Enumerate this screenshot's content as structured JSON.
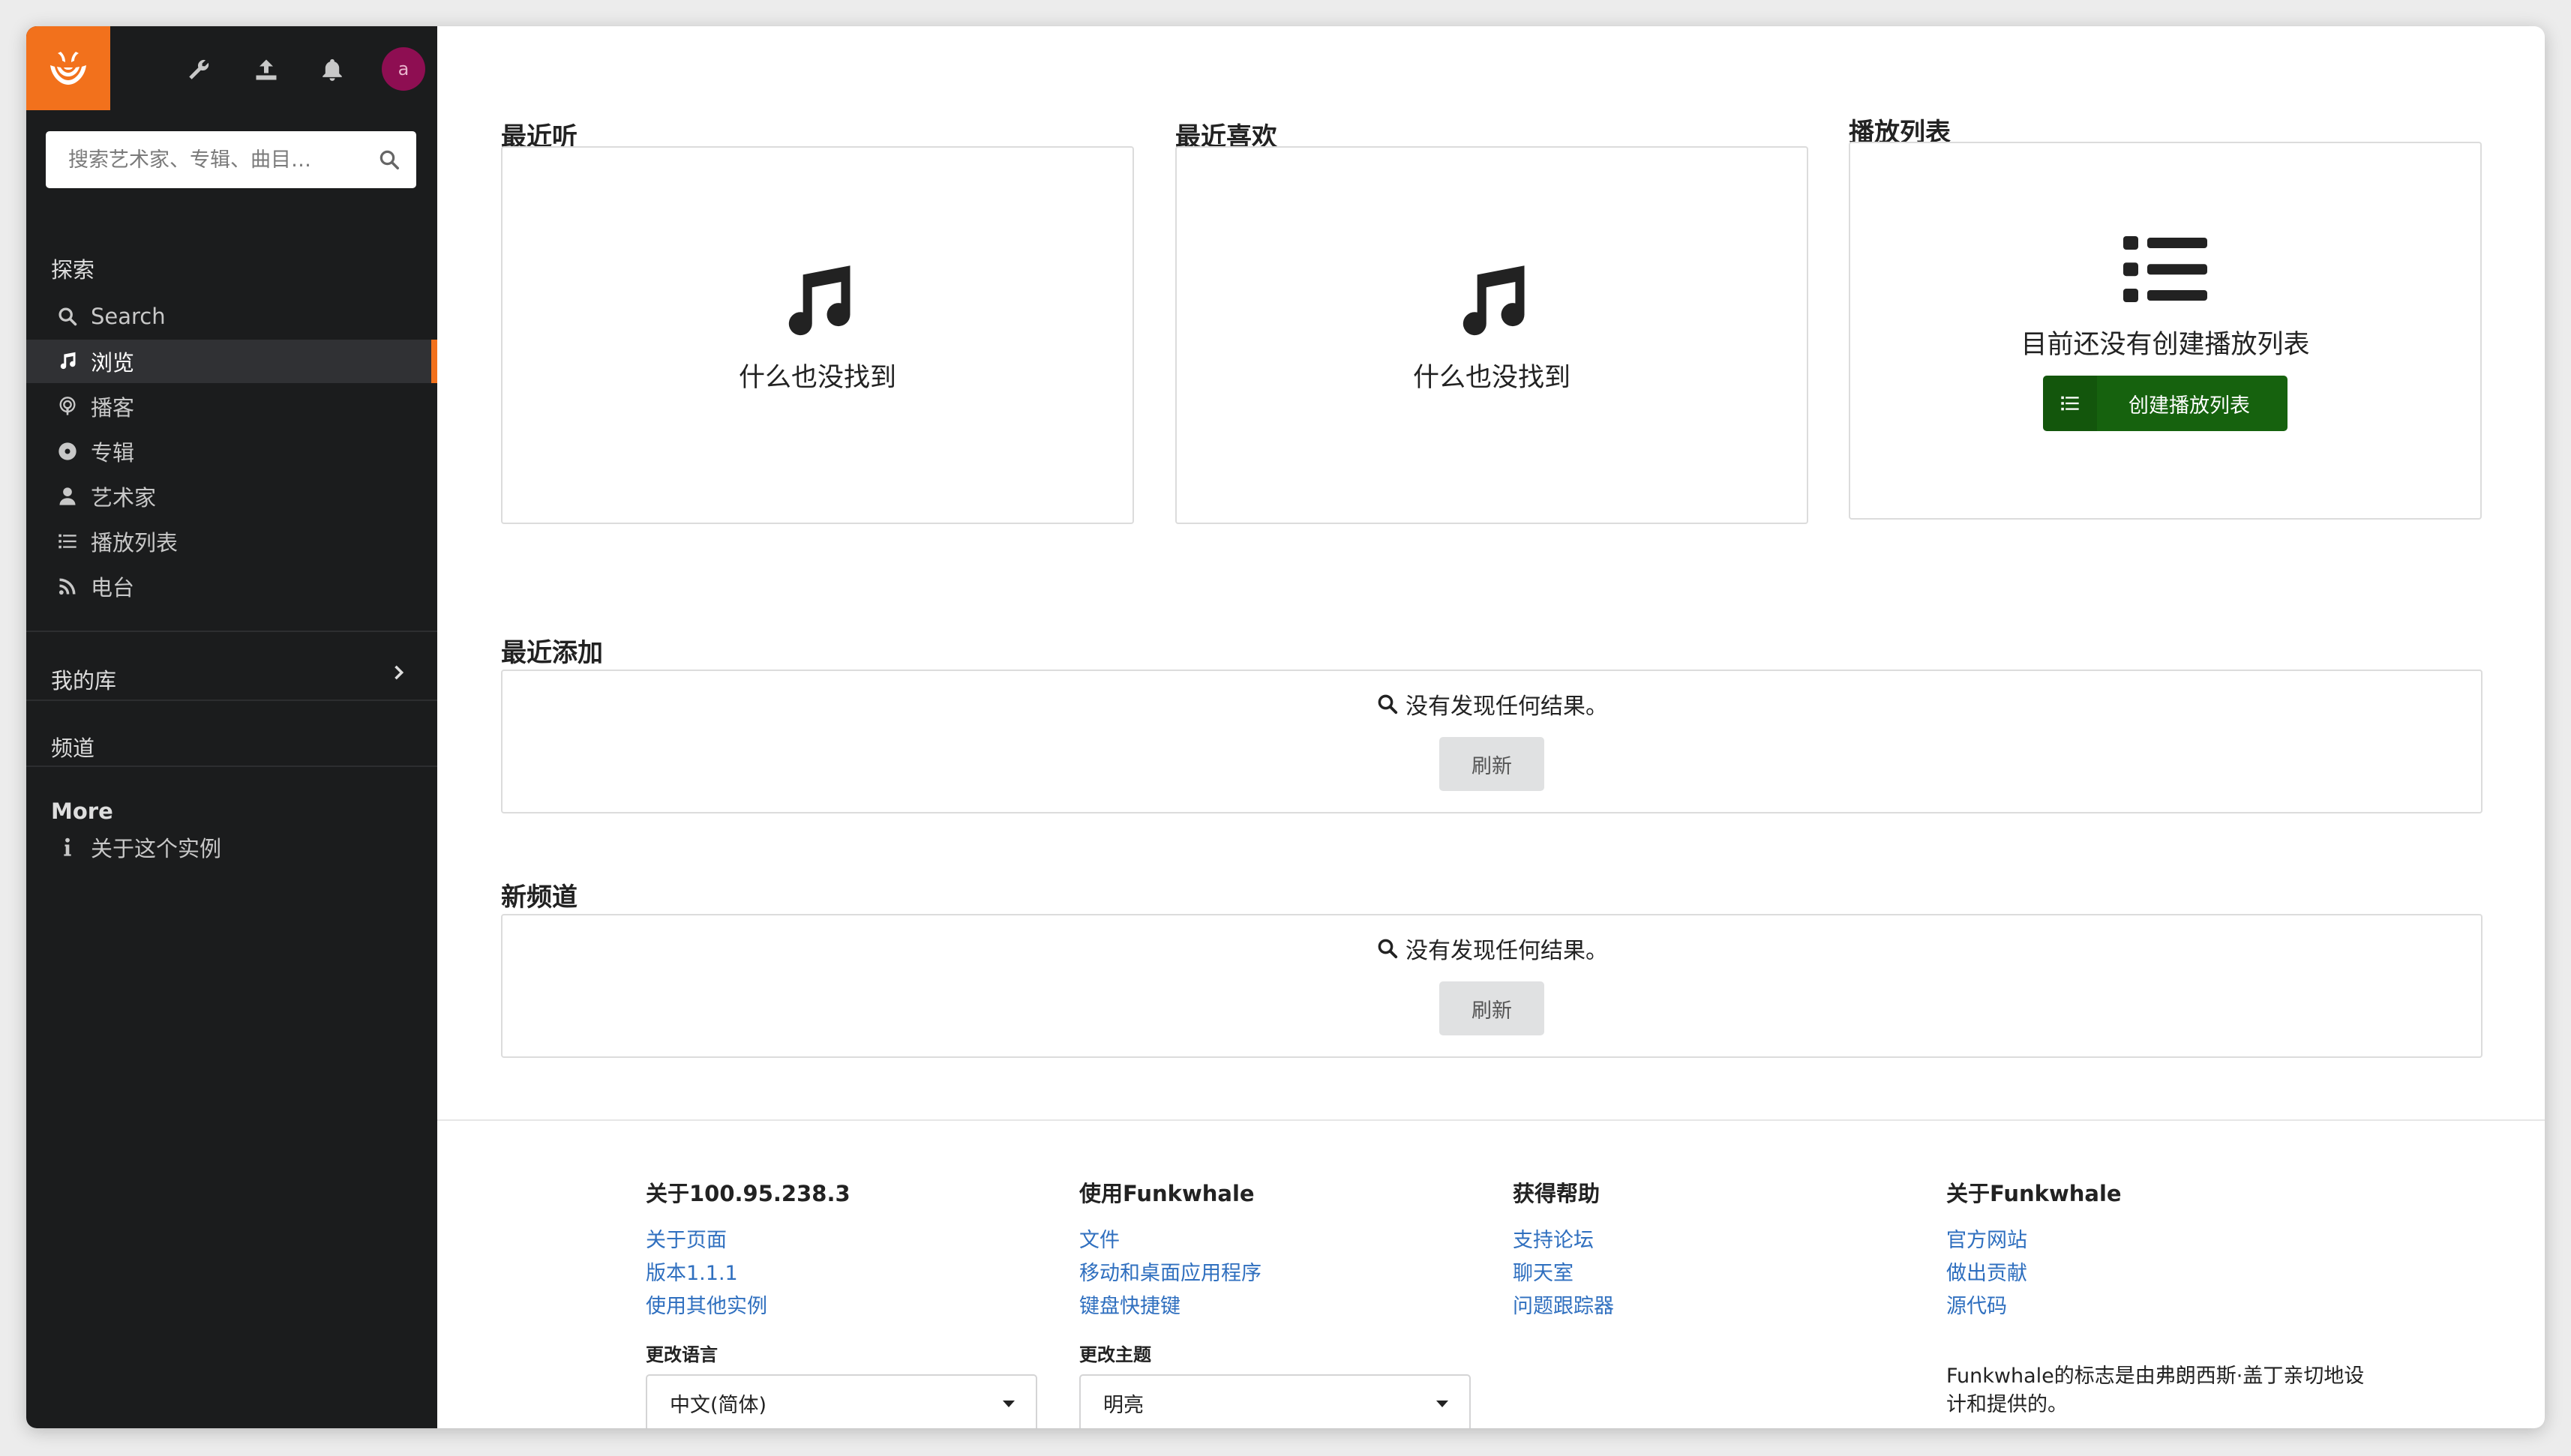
{
  "sidebar": {
    "search_placeholder": "搜索艺术家、专辑、曲目…",
    "explore_heading": "探索",
    "nav": [
      {
        "label": "Search",
        "icon": "search-icon"
      },
      {
        "label": "浏览",
        "icon": "music-note-icon",
        "active": true
      },
      {
        "label": "播客",
        "icon": "podcast-icon"
      },
      {
        "label": "专辑",
        "icon": "album-disc-icon"
      },
      {
        "label": "艺术家",
        "icon": "user-icon"
      },
      {
        "label": "播放列表",
        "icon": "list-icon"
      },
      {
        "label": "电台",
        "icon": "rss-icon"
      }
    ],
    "library_label": "我的库",
    "channels_label": "频道",
    "more_heading": "More",
    "about_instance": "关于这个实例",
    "avatar_initial": "a"
  },
  "main": {
    "recent_listened": {
      "title": "最近听",
      "empty": "什么也没找到"
    },
    "recent_liked": {
      "title": "最近喜欢",
      "empty": "什么也没找到"
    },
    "playlists": {
      "title": "播放列表",
      "empty": "目前还没有创建播放列表",
      "create_button": "创建播放列表"
    },
    "recent_added": {
      "title": "最近添加",
      "no_result": "没有发现任何结果。",
      "refresh": "刷新"
    },
    "new_channels": {
      "title": "新频道",
      "no_result": "没有发现任何结果。",
      "refresh": "刷新"
    }
  },
  "footer": {
    "about": {
      "title": "关于100.95.238.3",
      "links": [
        "关于页面",
        "版本1.1.1",
        "使用其他实例"
      ]
    },
    "use": {
      "title": "使用Funkwhale",
      "links": [
        "文件",
        "移动和桌面应用程序",
        "键盘快捷键"
      ]
    },
    "help": {
      "title": "获得帮助",
      "links": [
        "支持论坛",
        "聊天室",
        "问题跟踪器"
      ]
    },
    "funkwhale": {
      "title": "关于Funkwhale",
      "links": [
        "官方网站",
        "做出贡献",
        "源代码"
      ]
    },
    "language_label": "更改语言",
    "language_value": "中文(简体)",
    "theme_label": "更改主题",
    "theme_value": "明亮",
    "logo_note": "Funkwhale的标志是由弗朗西斯·盖丁亲切地设计和提供的。"
  },
  "colors": {
    "accent": "#f2711c",
    "sidebar_bg": "#1b1c1d",
    "create_button": "#16620e",
    "link": "#2f6fbf"
  }
}
